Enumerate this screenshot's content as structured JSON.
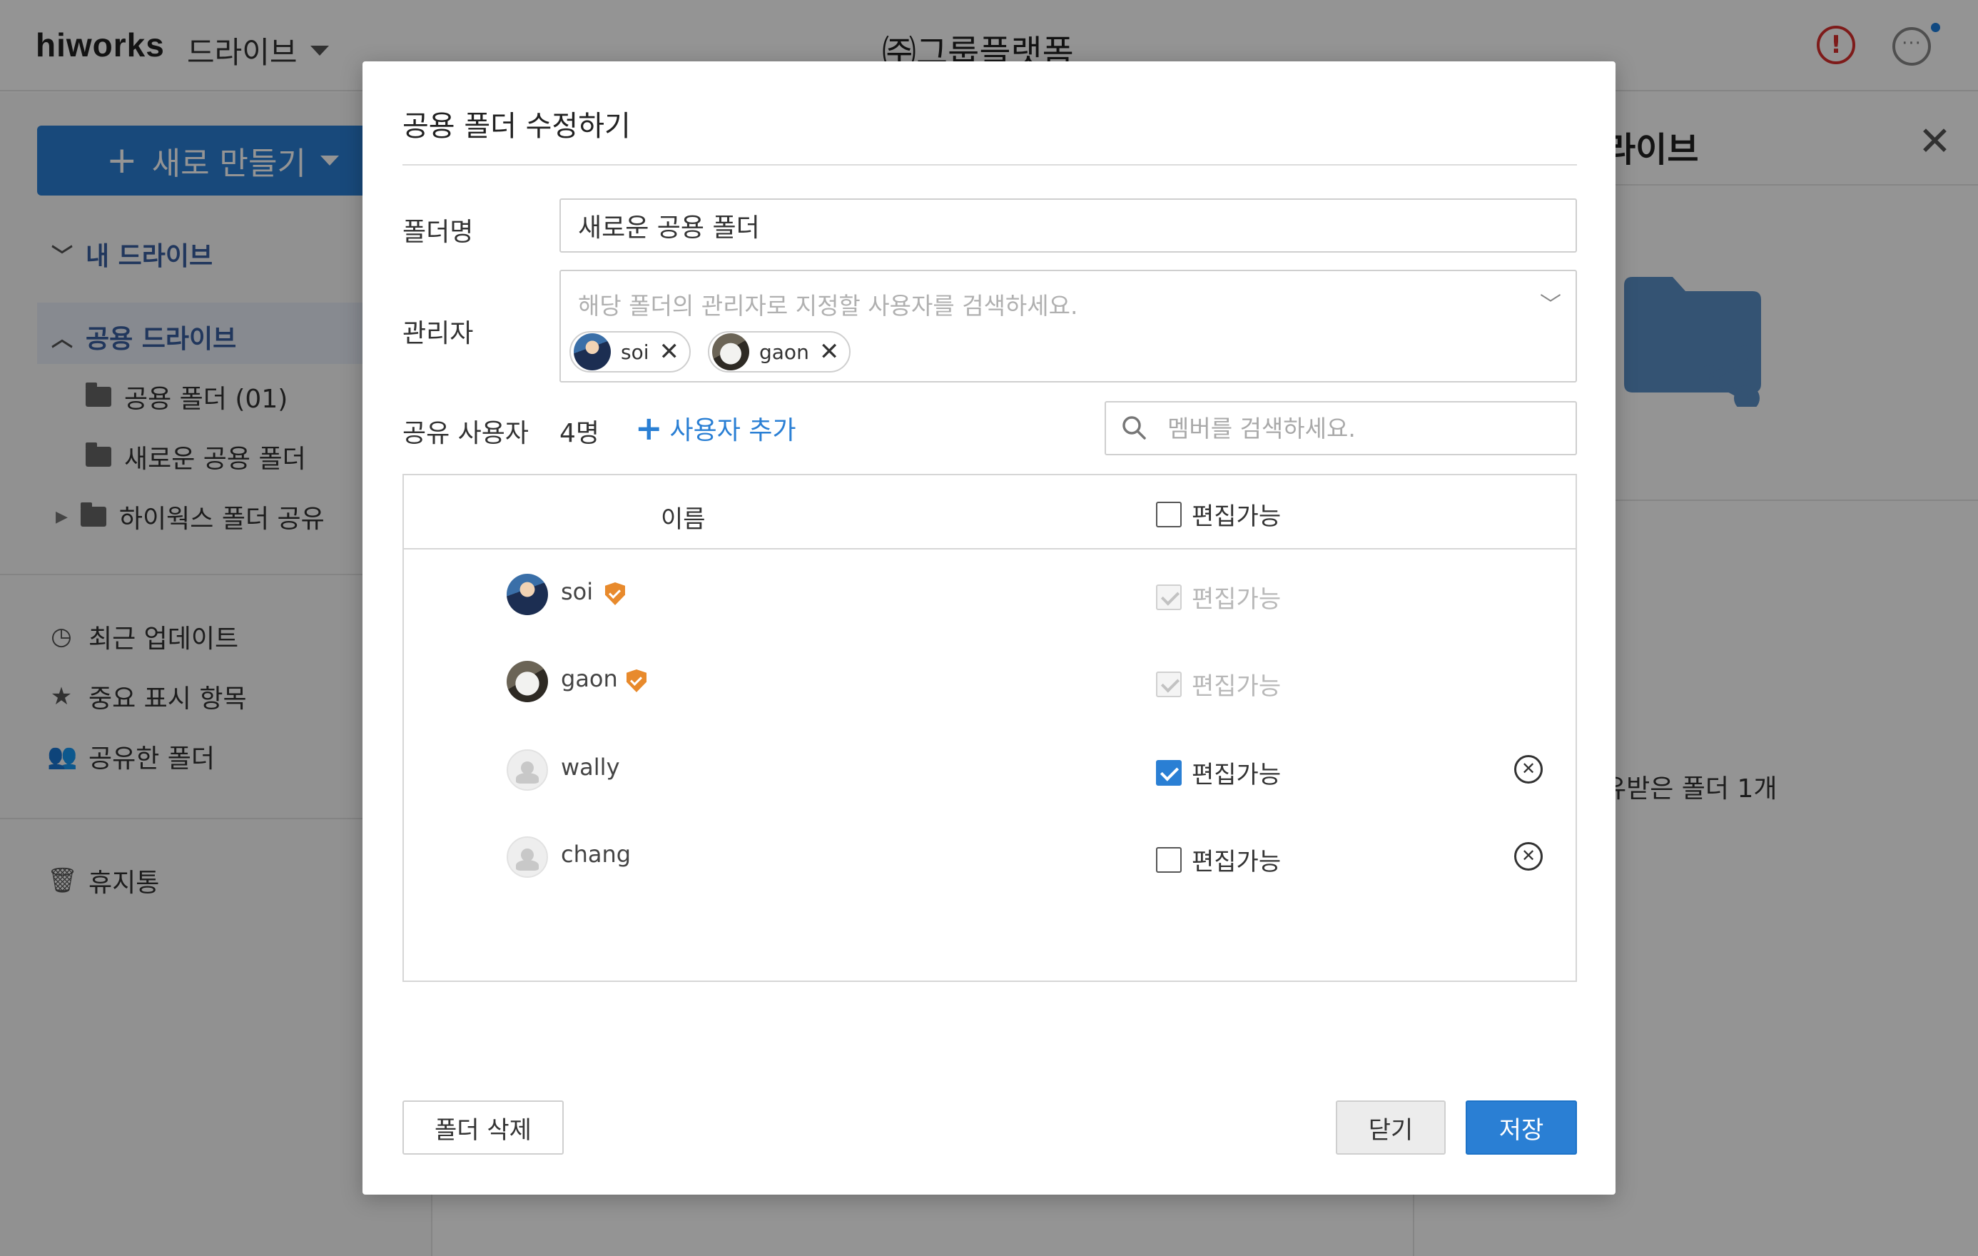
{
  "app": {
    "logo": "hiworks",
    "menu_label": "드라이브",
    "company_name": "㈜그룹플랫폼"
  },
  "sidebar": {
    "new_button": "새로 만들기",
    "my_drive": "내 드라이브",
    "shared_drive": "공용 드라이브",
    "folders": [
      "공용 폴더 (01)",
      "새로운 공용 폴더",
      "하이웍스 폴더 공유"
    ],
    "menu": [
      "최근 업데이트",
      "중요 표시 항목",
      "공유한 폴더"
    ],
    "trash": "휴지통"
  },
  "right_panel": {
    "title": "라이브",
    "info_text": "유받은 폴더 1개"
  },
  "modal": {
    "title": "공용 폴더 수정하기",
    "folder_name_label": "폴더명",
    "folder_name_value": "새로운 공용 폴더",
    "admin_label": "관리자",
    "admin_placeholder": "해당 폴더의 관리자로 지정할 사용자를 검색하세요.",
    "admins": [
      {
        "name": "soi"
      },
      {
        "name": "gaon"
      }
    ],
    "shared_users_label": "공유 사용자",
    "shared_users_count": "4명",
    "add_user_label": "사용자 추가",
    "member_search_placeholder": "멤버를 검색하세요.",
    "table": {
      "col_name": "이름",
      "col_editable": "편집가능",
      "header_checked": false,
      "rows": [
        {
          "name": "soi",
          "is_admin": true,
          "editable": true,
          "disabled": true,
          "removable": false
        },
        {
          "name": "gaon",
          "is_admin": true,
          "editable": true,
          "disabled": true,
          "removable": false
        },
        {
          "name": "wally",
          "is_admin": false,
          "editable": true,
          "disabled": false,
          "removable": true
        },
        {
          "name": "chang",
          "is_admin": false,
          "editable": false,
          "disabled": false,
          "removable": true
        }
      ]
    },
    "delete_button": "폴더 삭제",
    "close_button": "닫기",
    "save_button": "저장"
  },
  "colors": {
    "accent": "#2a7fd4",
    "admin_badge": "#e88a2c",
    "alert": "#d9302d"
  }
}
